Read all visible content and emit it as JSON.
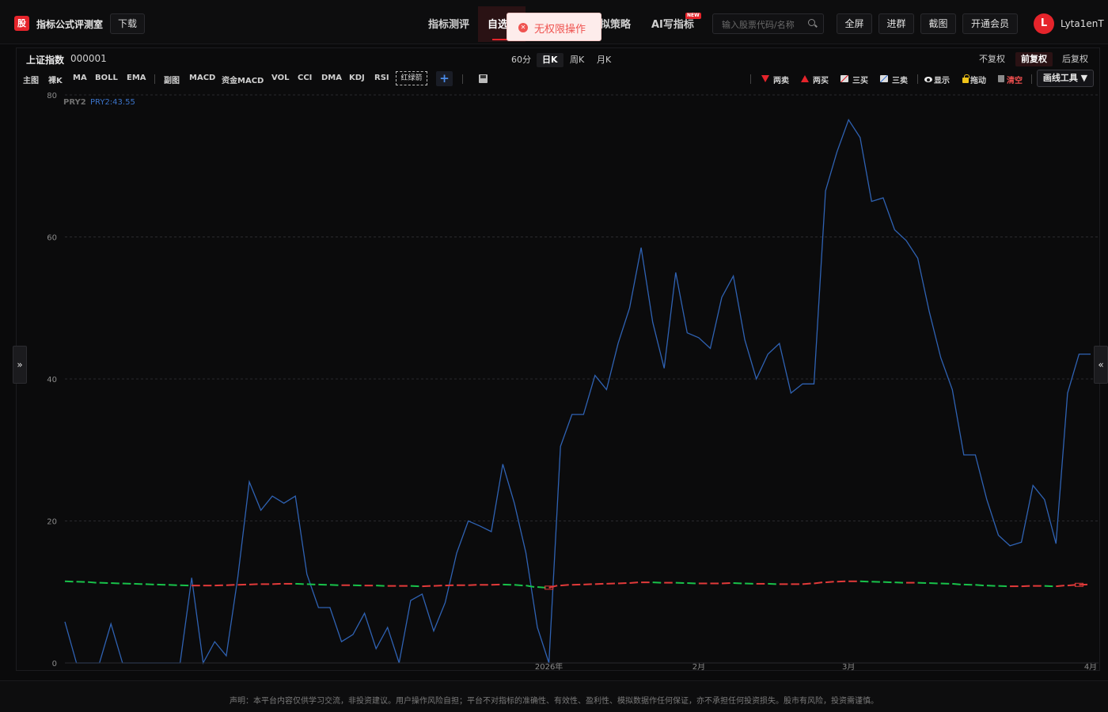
{
  "header": {
    "logo_char": "股",
    "app_title": "指标公式评测室",
    "download_label": "下载",
    "nav": [
      "指标测评",
      "自选",
      "模拟策略",
      "AI写指标"
    ],
    "new_badge": "NEW",
    "search_placeholder": "输入股票代码/名称",
    "buttons": [
      "全屏",
      "进群",
      "截图",
      "开通会员"
    ],
    "avatar_letter": "L",
    "username": "Lyta1enT"
  },
  "toast": {
    "message": "无权限操作"
  },
  "panel": {
    "stock_name": "上证指数",
    "stock_code": "000001",
    "periods": [
      "60分",
      "日K",
      "周K",
      "月K"
    ],
    "active_period": "日K",
    "adjust": [
      "不复权",
      "前复权",
      "后复权"
    ],
    "active_adjust": "前复权",
    "main_tools": [
      "主图",
      "裸K",
      "MA",
      "BOLL",
      "EMA"
    ],
    "sub_tools": [
      "副图",
      "MACD",
      "资金MACD",
      "VOL",
      "CCI",
      "DMA",
      "KDJ",
      "RSI"
    ],
    "indicator_box": "红绿箭",
    "plus": "+",
    "draw": {
      "two_sell": "两卖",
      "two_buy": "两买",
      "three_buy": "三买",
      "three_sell": "三卖",
      "show": "显示",
      "drag": "拖动",
      "clear": "清空",
      "tools": "画线工具 ▼"
    }
  },
  "chart_data": {
    "type": "line",
    "ylim": [
      0,
      80
    ],
    "yticks": [
      0,
      20,
      40,
      60,
      80
    ],
    "xticks": [
      "2026年",
      "2月",
      "3月",
      "4月"
    ],
    "legend": [
      "PRY2",
      "PRY2:43.55"
    ],
    "colors": {
      "main": "#2f62b3",
      "up": "#e23a3a",
      "down": "#18c24a"
    },
    "series": [
      {
        "values": [
          5.8,
          0,
          0,
          0,
          5.5,
          0,
          0,
          0,
          0,
          0,
          0,
          12,
          0,
          3,
          1,
          12,
          25.5,
          21.5,
          23.5,
          22.5,
          23.5,
          12.5,
          7.8,
          7.8,
          3,
          4,
          7,
          2,
          5,
          0,
          8.8,
          9.7,
          4.5,
          8.5,
          15.5,
          20,
          19.3,
          18.5,
          28,
          22.5,
          15.5,
          5,
          0,
          30.5,
          35,
          35,
          40.5,
          38.5,
          45,
          50,
          58.5,
          48,
          41.5,
          55,
          46.5,
          45.8,
          44.3,
          51.5,
          54.5,
          45.5,
          40,
          43.5,
          45,
          38,
          39.3,
          39.3,
          66.5,
          72,
          76.5,
          74,
          65,
          65.5,
          61,
          59.5,
          57,
          49.5,
          43,
          38.5,
          29.3,
          29.3,
          23,
          18,
          16.5,
          17,
          25,
          23,
          16.8,
          38,
          43.5,
          43.5
        ]
      },
      {
        "values": [
          11.5,
          11.45,
          11.4,
          11.3,
          11.25,
          11.2,
          11.15,
          11.1,
          11.05,
          11.0,
          10.95,
          10.9,
          10.9,
          10.9,
          10.95,
          11.0,
          11.05,
          11.1,
          11.1,
          11.15,
          11.15,
          11.1,
          11.05,
          11.0,
          10.95,
          10.95,
          10.9,
          10.9,
          10.85,
          10.85,
          10.85,
          10.8,
          10.85,
          10.9,
          10.95,
          10.95,
          11.0,
          11.0,
          11.05,
          11.0,
          10.9,
          10.7,
          10.6,
          10.9,
          11.0,
          11.05,
          11.1,
          11.15,
          11.2,
          11.25,
          11.35,
          11.35,
          11.3,
          11.3,
          11.25,
          11.2,
          11.2,
          11.2,
          11.25,
          11.2,
          11.15,
          11.15,
          11.1,
          11.1,
          11.1,
          11.2,
          11.35,
          11.45,
          11.5,
          11.5,
          11.45,
          11.4,
          11.35,
          11.3,
          11.3,
          11.25,
          11.2,
          11.15,
          11.05,
          11.0,
          10.9,
          10.85,
          10.8,
          10.8,
          10.85,
          10.85,
          10.8,
          10.9,
          11.0,
          11.05
        ]
      }
    ]
  },
  "footer": {
    "disclaimer": "声明：本平台内容仅供学习交流，非投资建议。用户操作风险自担；平台不对指标的准确性、有效性、盈利性、模拟数据作任何保证，亦不承担任何投资损失。股市有风险，投资需谨慎。"
  }
}
